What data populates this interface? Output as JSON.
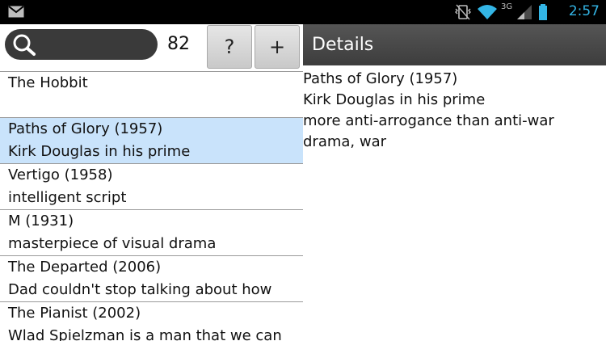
{
  "status_bar": {
    "time": "2:57",
    "network_label": "3G",
    "icons": [
      "mail-icon",
      "vibrate-icon",
      "wifi-icon",
      "signal-icon",
      "battery-icon"
    ]
  },
  "toolbar": {
    "count": "82",
    "help_label": "?",
    "add_label": "+"
  },
  "list": {
    "items": [
      {
        "title": "The Hobbit",
        "subtitle": ""
      },
      {
        "title": "Paths of Glory (1957)",
        "subtitle": "Kirk Douglas in his prime",
        "selected": true
      },
      {
        "title": "Vertigo (1958)",
        "subtitle": "intelligent script"
      },
      {
        "title": "M (1931)",
        "subtitle": "masterpiece of visual drama"
      },
      {
        "title": "The Departed (2006)",
        "subtitle": "Dad couldn't stop talking about how"
      },
      {
        "title": "The Pianist (2002)",
        "subtitle": "Wlad Spielzman is a man that we can"
      }
    ]
  },
  "details": {
    "header": "Details",
    "lines": [
      "Paths of Glory (1957)",
      "Kirk Douglas in his prime",
      "more anti-arrogance than anti-war",
      "drama, war"
    ]
  },
  "colors": {
    "status_bar_bg": "#000000",
    "clock": "#33b5e5",
    "selected_row": "#c9e3fb",
    "details_header_bg": "#484848",
    "search_pill": "#3a3a3a"
  }
}
